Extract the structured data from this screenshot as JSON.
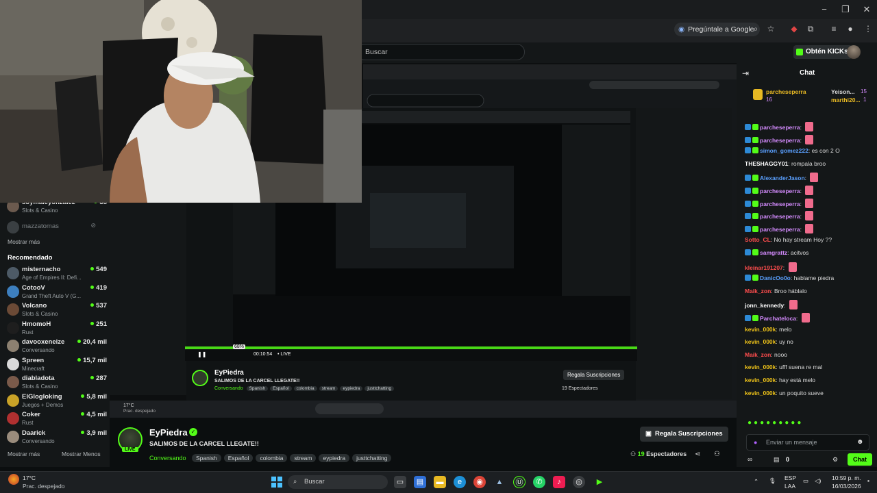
{
  "browser": {
    "ask_google": "Pregúntale a Google",
    "minimize": "−",
    "maximize": "❐",
    "close": "✕"
  },
  "header": {
    "search_placeholder": "Buscar",
    "kicks_button": "Obtén KICKs"
  },
  "sidebar": {
    "partial_top": {
      "name": "soymaleyonzalez",
      "sub": "Slots & Casino",
      "count": "38"
    },
    "offline": {
      "name": "mazzatomas"
    },
    "show_more_1": "Mostrar más",
    "recommended_heading": "Recomendado",
    "recommended": [
      {
        "name": "misternacho",
        "sub": "Age of Empires II: Defi...",
        "count": "549",
        "color": "#4d5a66"
      },
      {
        "name": "CotooV",
        "sub": "Grand Theft Auto V (G...",
        "count": "419",
        "color": "#3d7fbf"
      },
      {
        "name": "Volcano",
        "sub": "Slots & Casino",
        "count": "537",
        "color": "#6b4a36"
      },
      {
        "name": "HmomoH",
        "sub": "Rust",
        "count": "251",
        "color": "#1e1e1e"
      },
      {
        "name": "davooxeneize",
        "sub": "Conversando",
        "count": "20,4 mil",
        "color": "#8c8070"
      },
      {
        "name": "Spreen",
        "sub": "Minecraft",
        "count": "15,7 mil",
        "color": "#d9d9d9"
      },
      {
        "name": "diabladota",
        "sub": "Slots & Casino",
        "count": "287",
        "color": "#7a5a4a"
      },
      {
        "name": "ElGlogloking",
        "sub": "Juegos + Demos",
        "count": "5,8 mil",
        "color": "#c9a227"
      },
      {
        "name": "Coker",
        "sub": "Rust",
        "count": "4,5 mil",
        "color": "#b03030"
      },
      {
        "name": "Daarick",
        "sub": "Conversando",
        "count": "3,9 mil",
        "color": "#9a8c7c"
      }
    ],
    "show_more_2": "Mostrar más",
    "show_less": "Mostrar Menos"
  },
  "stream_info": {
    "streamer": "EyPiedra",
    "live_badge": "LIVE",
    "title": "SALIMOS DE LA CARCEL LLEGATE!!",
    "category": "Conversando",
    "tags": [
      "Spanish",
      "Español",
      "colombia",
      "stream",
      "eypiedra",
      "justtchatting"
    ],
    "subs_button": "Regala Suscripciones",
    "viewers_count": "19",
    "viewers_label": "Espectadores"
  },
  "nested_player": {
    "streamer": "EyPiedra",
    "title": "SALIMOS DE LA CARCEL LLEGATE!!",
    "category": "Conversando",
    "tags": [
      "Spanish",
      "Español",
      "colombia",
      "stream",
      "eypiedra",
      "justtchatting"
    ],
    "time": "00:10:54",
    "live": "• LIVE",
    "volume": "68%",
    "subs_button": "Regala Suscripciones",
    "viewers": "19 Espectadores",
    "weather_temp": "17°C",
    "weather_desc": "Prac. despejado"
  },
  "chat": {
    "title": "Chat",
    "pinned": [
      {
        "user": "parcheseperra",
        "count": "16"
      },
      {
        "user": "Yeison...",
        "count": "15"
      },
      {
        "user": "marthi20...",
        "count": "1"
      }
    ],
    "messages": [
      {
        "user": "parcheseperra",
        "text": "",
        "color": "#d58cff",
        "emote": true
      },
      {
        "user": "parcheseperra",
        "text": "",
        "color": "#d58cff",
        "emote": true
      },
      {
        "user": "simon_gomez222",
        "text": "es con 2 O",
        "color": "#5aa0ff"
      },
      {
        "user": "THESHAGGY01",
        "text": "rompala broo",
        "color": "#ffffff"
      },
      {
        "user": "AlexanderJason",
        "text": "",
        "color": "#5aa0ff",
        "emote": true
      },
      {
        "user": "parcheseperra",
        "text": "",
        "color": "#d58cff",
        "emote": true
      },
      {
        "user": "parcheseperra",
        "text": "",
        "color": "#d58cff",
        "emote": true
      },
      {
        "user": "parcheseperra",
        "text": "",
        "color": "#d58cff",
        "emote": true
      },
      {
        "user": "parcheseperra",
        "text": "",
        "color": "#d58cff",
        "emote": true
      },
      {
        "user": "Sotto_CL",
        "text": "No hay stream Hoy ??",
        "color": "#ff4d4d"
      },
      {
        "user": "samgrattz",
        "text": "acitvos",
        "color": "#d58cff"
      },
      {
        "user": "kleinar191207",
        "text": "",
        "color": "#ff4d4d",
        "emote": true
      },
      {
        "user": "DanicOo0o",
        "text": "hablame piedra",
        "color": "#5aa0ff"
      },
      {
        "user": "Maik_zon",
        "text": "Broo háblalo",
        "color": "#ff4d4d"
      },
      {
        "user": "jonn_kennedy",
        "text": "",
        "color": "#ffffff",
        "emote": true
      },
      {
        "user": "Parchateloca",
        "text": "",
        "color": "#d58cff",
        "emote": true
      },
      {
        "user": "kevin_000k",
        "text": "melo",
        "color": "#f0c419"
      },
      {
        "user": "kevin_000k",
        "text": "uy no",
        "color": "#f0c419"
      },
      {
        "user": "Maik_zon",
        "text": "nooo",
        "color": "#ff4d4d"
      },
      {
        "user": "kevin_000k",
        "text": "ufff suena re mal",
        "color": "#f0c419"
      },
      {
        "user": "kevin_000k",
        "text": "hay está melo",
        "color": "#f0c419"
      },
      {
        "user": "kevin_000k",
        "text": "un poquito sueve",
        "color": "#f0c419"
      }
    ],
    "input_placeholder": "Enviar un mensaje",
    "points": "0",
    "send_button": "Chat"
  },
  "taskbar": {
    "weather_temp": "17°C",
    "weather_desc": "Prac. despejado",
    "search_placeholder": "Buscar",
    "lang_line1": "ESP",
    "lang_line2": "LAA",
    "time": "10:59 p. m.",
    "date": "16/03/2026"
  },
  "colors": {
    "kick_green": "#53fc18",
    "panel": "#141718",
    "background": "#0b0e0f"
  }
}
